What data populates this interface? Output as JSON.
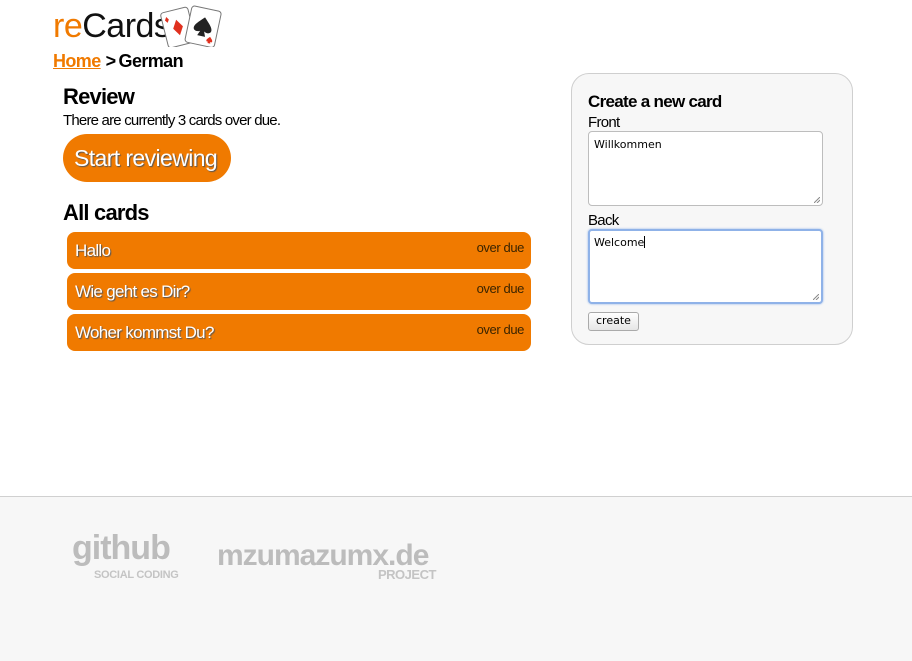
{
  "logo": {
    "re": "re",
    "cards": "Cards"
  },
  "breadcrumb": {
    "home": "Home",
    "separator": ">",
    "current": "German"
  },
  "review": {
    "title": "Review",
    "overdue_text": "There are currently 3 cards over due.",
    "start_button": "Start reviewing"
  },
  "all_cards": {
    "title": "All cards",
    "items": [
      {
        "front": "Hallo",
        "status": "over due"
      },
      {
        "front": "Wie geht es Dir?",
        "status": "over due"
      },
      {
        "front": "Woher kommst Du?",
        "status": "over due"
      }
    ]
  },
  "create": {
    "title": "Create a new card",
    "front_label": "Front",
    "front_value": "Willkommen",
    "back_label": "Back",
    "back_value": "Welcome",
    "button": "create"
  },
  "footer": {
    "github": "github",
    "github_sub": "SOCIAL CODING",
    "mzumazumx": "mzumazumx.de",
    "mzumazumx_sub": "PROJECT"
  },
  "colors": {
    "accent": "#f07a00",
    "footer_bg": "#f7f7f7",
    "panel_bg": "#f7f7f7"
  }
}
